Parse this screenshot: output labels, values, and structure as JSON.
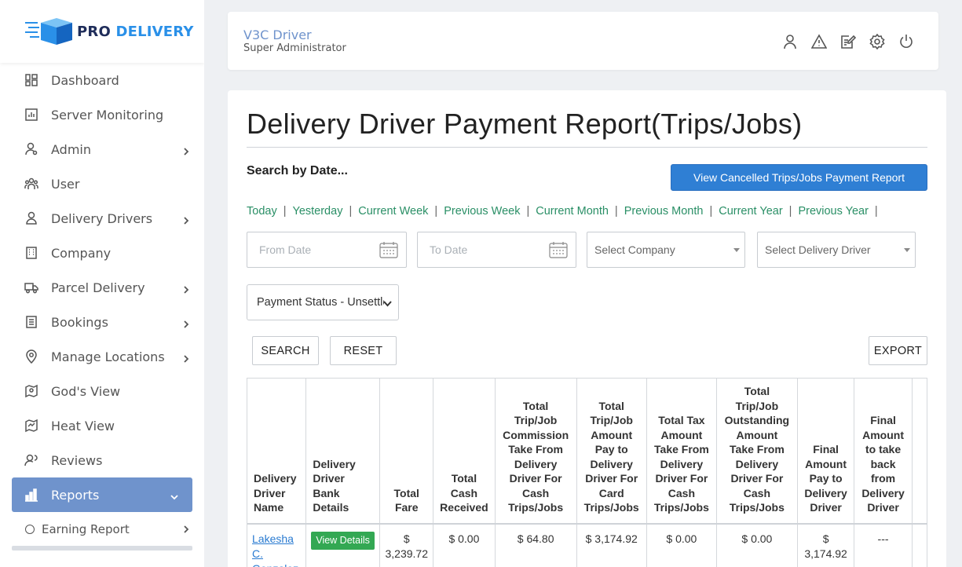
{
  "brand": {
    "pro": "PRO",
    "delivery": "DELIVERY"
  },
  "sidebar": {
    "items": [
      {
        "label": "Dashboard",
        "icon": "dashboard-icon",
        "chevron": false
      },
      {
        "label": "Server Monitoring",
        "icon": "chart-icon",
        "chevron": false
      },
      {
        "label": "Admin",
        "icon": "admin-icon",
        "chevron": true
      },
      {
        "label": "User",
        "icon": "users-icon",
        "chevron": false
      },
      {
        "label": "Delivery Drivers",
        "icon": "driver-icon",
        "chevron": true
      },
      {
        "label": "Company",
        "icon": "building-icon",
        "chevron": false
      },
      {
        "label": "Parcel Delivery",
        "icon": "truck-icon",
        "chevron": true
      },
      {
        "label": "Bookings",
        "icon": "list-icon",
        "chevron": true
      },
      {
        "label": "Manage Locations",
        "icon": "pin-icon",
        "chevron": true
      },
      {
        "label": "God's View",
        "icon": "map-icon",
        "chevron": false
      },
      {
        "label": "Heat View",
        "icon": "heatmap-icon",
        "chevron": false
      },
      {
        "label": "Reviews",
        "icon": "reviews-icon",
        "chevron": false
      },
      {
        "label": "Reports",
        "icon": "bar-chart-icon",
        "chevron": true,
        "active": true
      }
    ],
    "sub_items": [
      {
        "label": "Earning Report"
      }
    ]
  },
  "header": {
    "user_name": "V3C Driver",
    "user_role": "Super Administrator",
    "icons": [
      "user-icon",
      "alert-icon",
      "edit-icon",
      "settings-icon",
      "power-icon"
    ]
  },
  "main": {
    "title": "Delivery Driver Payment Report(Trips/Jobs)",
    "search_label": "Search by Date...",
    "cancel_button": "View Cancelled Trips/Jobs Payment Report",
    "quick_links": [
      "Today",
      "Yesterday",
      "Current Week",
      "Previous Week",
      "Current Month",
      "Previous Month",
      "Current Year",
      "Previous Year"
    ],
    "from_date_placeholder": "From Date",
    "to_date_placeholder": "To Date",
    "company_select": "Select Company",
    "driver_select": "Select Delivery Driver",
    "payment_status": "Payment Status - Unsettled",
    "search_button": "SEARCH",
    "reset_button": "RESET",
    "export_button": "EXPORT"
  },
  "table": {
    "headers": [
      "Delivery Driver Name",
      "Delivery Driver Bank Details",
      "Total Fare",
      "Total Cash Received",
      "Total Trip/Job Commission Take From Delivery Driver For Cash Trips/Jobs",
      "Total Trip/Job Amount Pay to Delivery Driver For Card Trips/Jobs",
      "Total Tax Amount Take From Delivery Driver For Cash Trips/Jobs",
      "Total Trip/Job Outstanding Amount Take From Delivery Driver For Cash Trips/Jobs",
      "Final Amount Pay to Delivery Driver",
      "Final Amount to take back from Delivery Driver"
    ],
    "rows": [
      {
        "driver_name": "Lakesha C. Gonzalez",
        "bank_button": "View Details",
        "total_fare": "$ 3,239.72",
        "cash_received": "$ 0.00",
        "commission": "$ 64.80",
        "card_pay": "$ 3,174.92",
        "tax": "$ 0.00",
        "outstanding": "$ 0.00",
        "final_pay": "$ 3,174.92",
        "take_back": "---"
      }
    ]
  }
}
